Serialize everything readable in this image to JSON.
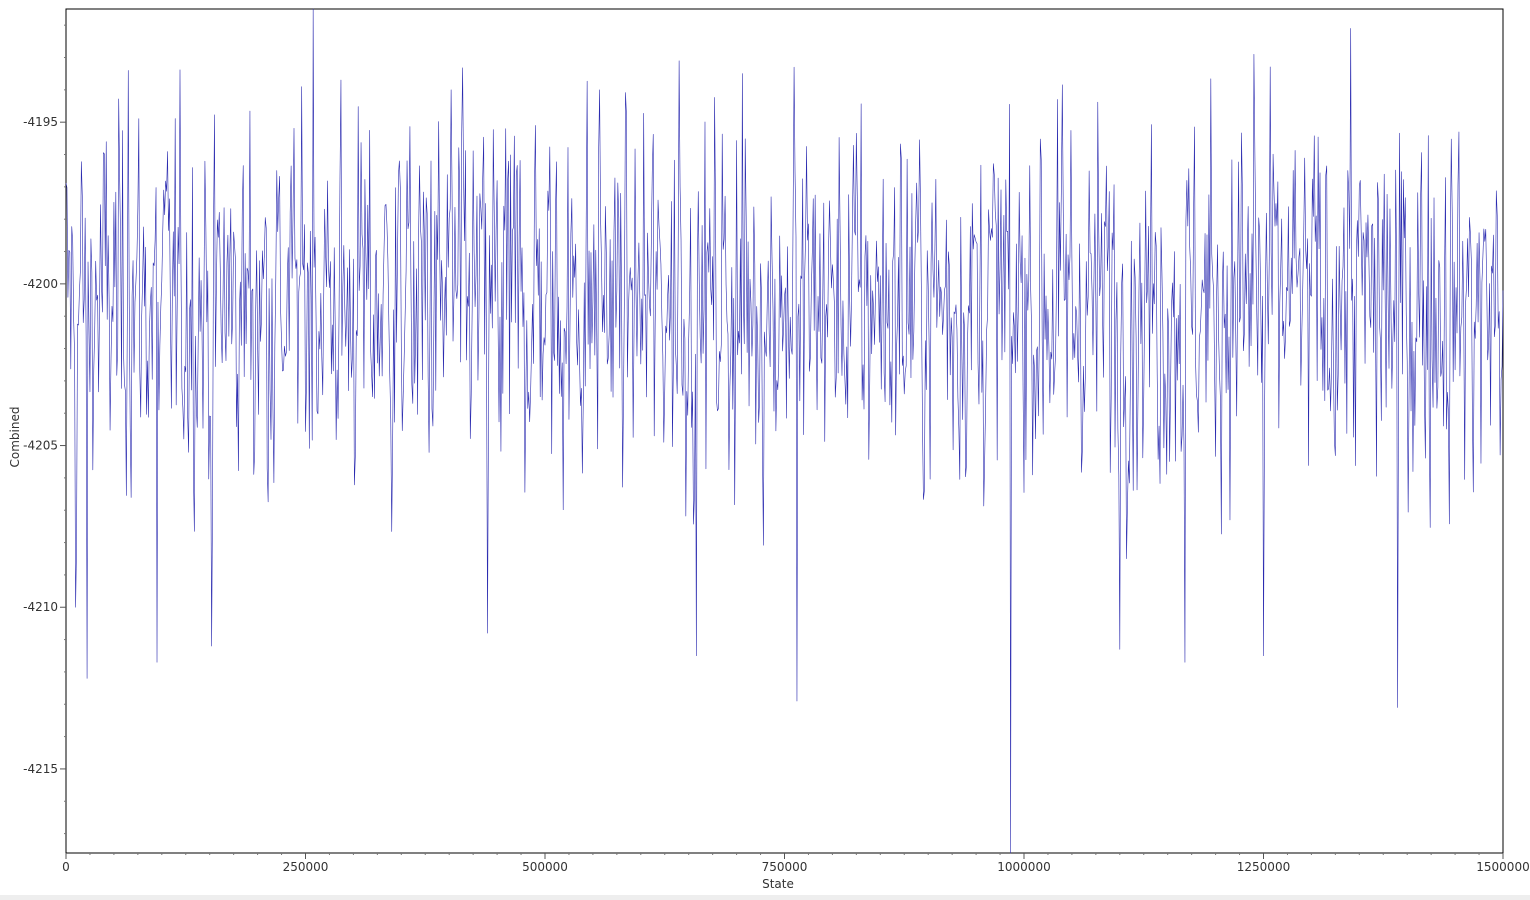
{
  "chart_data": {
    "type": "line",
    "title": "",
    "xlabel": "State",
    "ylabel": "Combined",
    "xlim": [
      0,
      1500000
    ],
    "ylim": [
      -4217.6,
      -4191.5
    ],
    "x_ticks": [
      0,
      250000,
      500000,
      750000,
      1000000,
      1250000,
      1500000
    ],
    "x_tick_labels": [
      "0",
      "250000",
      "500000",
      "750000",
      "1000000",
      "1250000",
      "1500000"
    ],
    "y_ticks": [
      -4195,
      -4200,
      -4205,
      -4210,
      -4215
    ],
    "y_tick_labels": [
      "-4195",
      "-4200",
      "-4205",
      "-4210",
      "-4215"
    ],
    "grid": false,
    "legend": "none",
    "series": [
      {
        "color": "#2b2bb0",
        "x_step": 1000,
        "x_start": 0,
        "y_mean": -4200.5,
        "y_spread": 3.2,
        "extremes": [
          {
            "x": 10000,
            "y": -4210.0
          },
          {
            "x": 22000,
            "y": -4212.2
          },
          {
            "x": 65000,
            "y": -4193.4
          },
          {
            "x": 95000,
            "y": -4211.7
          },
          {
            "x": 152000,
            "y": -4211.2
          },
          {
            "x": 258000,
            "y": -4191.5
          },
          {
            "x": 402000,
            "y": -4194.0
          },
          {
            "x": 440000,
            "y": -4210.8
          },
          {
            "x": 557000,
            "y": -4194.0
          },
          {
            "x": 640000,
            "y": -4193.1
          },
          {
            "x": 658000,
            "y": -4211.5
          },
          {
            "x": 760000,
            "y": -4193.3
          },
          {
            "x": 763000,
            "y": -4212.9
          },
          {
            "x": 986000,
            "y": -4217.6
          },
          {
            "x": 1100000,
            "y": -4211.3
          },
          {
            "x": 1168000,
            "y": -4211.7
          },
          {
            "x": 1240000,
            "y": -4192.9
          },
          {
            "x": 1250000,
            "y": -4211.5
          },
          {
            "x": 1341000,
            "y": -4192.1
          },
          {
            "x": 1390000,
            "y": -4213.1
          },
          {
            "x": 1500000,
            "y": -4200.2
          }
        ]
      }
    ]
  }
}
